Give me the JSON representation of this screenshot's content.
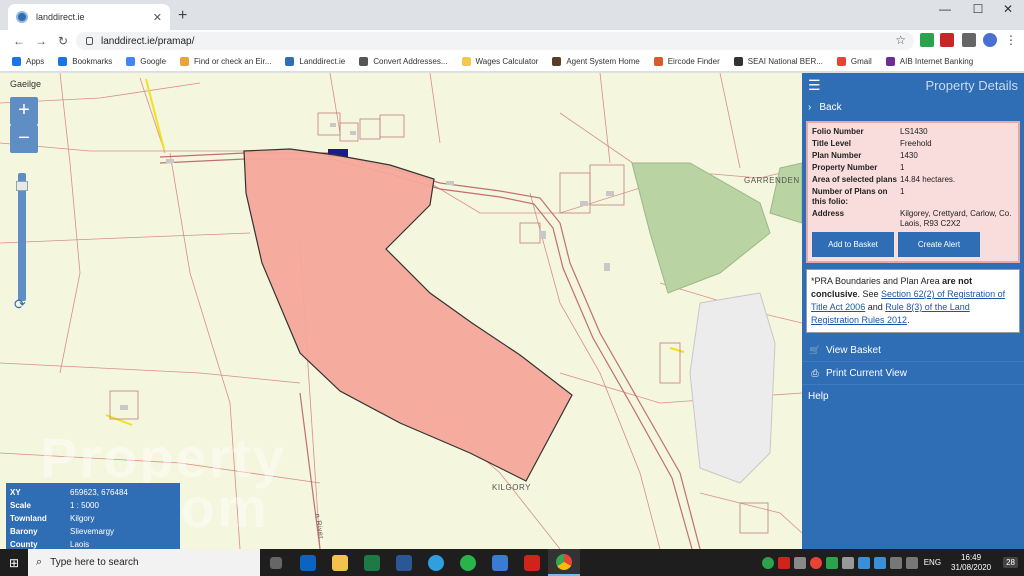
{
  "browser": {
    "tab_title": "landdirect.ie",
    "url": "landdirect.ie/pramap/",
    "bookmarks": [
      {
        "label": "Apps",
        "color": "#1a73e8"
      },
      {
        "label": "Bookmarks",
        "color": "#1a73e8"
      },
      {
        "label": "Google",
        "color": "#4285f4"
      },
      {
        "label": "Find or check an Eir...",
        "color": "#e8a33d"
      },
      {
        "label": "Landdirect.ie",
        "color": "#2f6db5"
      },
      {
        "label": "Convert Addresses...",
        "color": "#555555"
      },
      {
        "label": "Wages Calculator",
        "color": "#f2c94c"
      },
      {
        "label": "Agent System Home",
        "color": "#5b3a29"
      },
      {
        "label": "Eircode Finder",
        "color": "#d35d2d"
      },
      {
        "label": "SEAI National BER...",
        "color": "#333333"
      },
      {
        "label": "Gmail",
        "color": "#ea4335"
      },
      {
        "label": "AIB Internet Banking",
        "color": "#6f2c91"
      }
    ]
  },
  "map": {
    "language_link": "Gaeilge",
    "zoom_in": "+",
    "zoom_out": "−",
    "place_garrenden": "GARRENDEN",
    "place_kilgory": "KILGORY",
    "road_label": "n River",
    "watermark": "Property Pal.com",
    "info": {
      "xy_label": "XY",
      "xy_value": "659623, 676484",
      "scale_label": "Scale",
      "scale_value": "1 : 5000",
      "townland_label": "Townland",
      "townland_value": "Kilgory",
      "barony_label": "Barony",
      "barony_value": "Slievemargy",
      "county_label": "County",
      "county_value": "Laois"
    }
  },
  "panel": {
    "title": "Property Details",
    "back": "Back",
    "folio": {
      "folio_number_label": "Folio Number",
      "folio_number": "LS1430",
      "title_level_label": "Title Level",
      "title_level": "Freehold",
      "plan_number_label": "Plan Number",
      "plan_number": "1430",
      "property_number_label": "Property Number",
      "property_number": "1",
      "area_label": "Area of selected plans",
      "area": "14.84 hectares.",
      "plans_count_label": "Number of Plans on this folio:",
      "plans_count": "1",
      "address_label": "Address",
      "address": "Kilgorey, Crettyard, Carlow, Co. Laois, R93 C2X2"
    },
    "add_basket": "Add to Basket",
    "create_alert": "Create Alert",
    "note": {
      "p1": "*PRA Boundaries and Plan Area ",
      "bold": "are not conclusive",
      "p2": ". See ",
      "link1": "Section 62(2) of Registration of Title Act 2006",
      "p3": " and ",
      "link2": "Rule 8(3) of the Land Registration Rules 2012",
      "p4": "."
    },
    "view_basket": "View Basket",
    "print_view": "Print Current View",
    "help": "Help"
  },
  "taskbar": {
    "search_placeholder": "Type here to search",
    "lang": "ENG",
    "time": "16:49",
    "date": "31/08/2020",
    "notif_count": "28"
  }
}
